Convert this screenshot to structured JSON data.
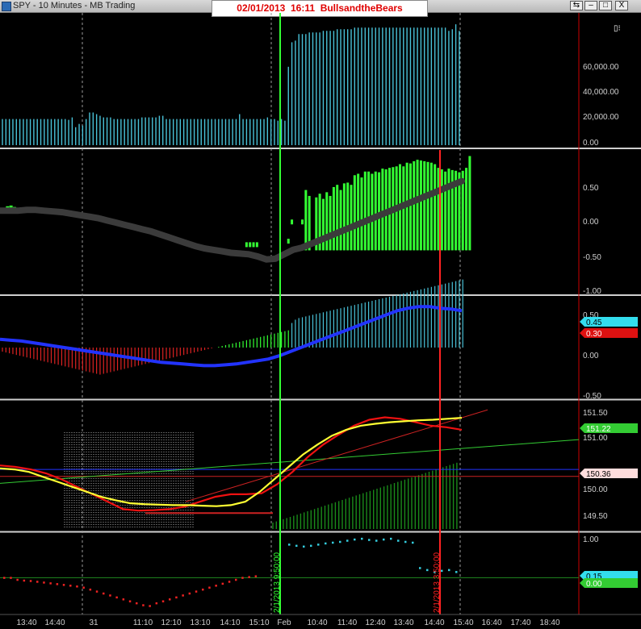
{
  "window": {
    "title": "SPY - 10 Minutes - MB Trading",
    "banner": "02/01/2013  16:11  BullsandtheBears",
    "buttons": [
      "⇆",
      "–",
      "□",
      "X"
    ]
  },
  "colors": {
    "background": "#000000",
    "volume_bars": "#49c2d8",
    "histogram_green": "#33ff33",
    "histogram_red": "#dd2222",
    "ma_line": "#3b3b3b",
    "trend_line": "#2233ff",
    "price_red": "#ee1111",
    "price_yellow": "#ffff33",
    "price_green": "#33cc33",
    "dots_cyan": "#33ccdd",
    "dots_red": "#ee2222",
    "marker_red": "#ff2222",
    "marker_green": "#33ff33",
    "axis_text": "#d0d0d0"
  },
  "chart_data": {
    "type": "bar",
    "symbol": "SPY",
    "interval": "10 Minutes",
    "x_axis": {
      "tick_labels": [
        "13:40",
        "14:40",
        "31",
        "11:10",
        "12:10",
        "13:10",
        "14:10",
        "15:10",
        "Feb",
        "10:40",
        "11:40",
        "12:40",
        "13:40",
        "14:40",
        "15:40",
        "16:40",
        "17:40",
        "18:40"
      ],
      "vertical_markers": [
        {
          "label": "2/1/2013 9:50:00",
          "color": "green"
        },
        {
          "label": "2/1/2013 3:50:00",
          "color": "red"
        }
      ]
    },
    "panels": [
      {
        "name": "volume",
        "type": "bar",
        "y_ticks": [
          "60,000.00",
          "40,000.00",
          "20,000.00",
          "0.00"
        ],
        "ylim": [
          0,
          80000
        ],
        "values": [
          16000,
          16000,
          16000,
          16000,
          16000,
          16000,
          16000,
          16000,
          16000,
          16000,
          16000,
          16000,
          16000,
          16000,
          16000,
          16000,
          16000,
          16000,
          16000,
          15500,
          17000,
          11000,
          13000,
          12000,
          16000,
          20000,
          20000,
          19000,
          18000,
          17000,
          17000,
          17000,
          16000,
          16000,
          16000,
          16000,
          16000,
          16000,
          16000,
          16000,
          17000,
          17000,
          17000,
          17000,
          17000,
          18000,
          18000,
          16000,
          16000,
          16000,
          16000,
          16000,
          16000,
          16000,
          16000,
          16000,
          16000,
          16000,
          16000,
          16000,
          16000,
          16000,
          16000,
          16000,
          16000,
          16000,
          16000,
          16000,
          19000,
          16000,
          16000,
          16000,
          16000,
          16000,
          16000,
          16000,
          17000,
          16000,
          16000,
          15000,
          16000,
          15000,
          48000,
          63000,
          64000,
          68000,
          68000,
          68000,
          69000,
          69000,
          69000,
          69000,
          70000,
          70000,
          70000,
          70000,
          71000,
          71000,
          71000,
          71000,
          71000,
          72000,
          72000,
          72000,
          72000,
          72000,
          72000,
          72000,
          72000,
          72000,
          72000,
          72000,
          72000,
          72000,
          72000,
          72000,
          72000,
          72000,
          72000,
          72000,
          72000,
          72000,
          72000,
          72000,
          72000,
          72000,
          72000,
          72000,
          70000,
          71000,
          74000,
          70000
        ]
      },
      {
        "name": "oscillator-histogram",
        "type": "bar",
        "y_ticks": [
          "0.50",
          "0.00",
          "-0.50",
          "-1.00"
        ],
        "ylim": [
          -1.0,
          0.9
        ],
        "bars": [
          0.14,
          0.16,
          0.17,
          0.15,
          0,
          0,
          0,
          0,
          0,
          0,
          0,
          0,
          0,
          0,
          0,
          0,
          0,
          0,
          0,
          0,
          0,
          0,
          0,
          0,
          0,
          0,
          0,
          0,
          0,
          0,
          0,
          0,
          0,
          0,
          0,
          0,
          0,
          0,
          0,
          0,
          0,
          0,
          0,
          0,
          0,
          0,
          0,
          0,
          0,
          0,
          0,
          0,
          0,
          0,
          0,
          0,
          0,
          0,
          0,
          0,
          0,
          0,
          0,
          0,
          0,
          0,
          0,
          0,
          0,
          0,
          -0.37,
          -0.36,
          -0.37,
          -0.39,
          0,
          0,
          0,
          0,
          0,
          0,
          0,
          0,
          -0.28,
          -0.02,
          0.0,
          0.0,
          -0.02,
          0.38,
          0.3,
          0.0,
          0.28,
          0.33,
          0.26,
          0.35,
          0.3,
          0.42,
          0.45,
          0.38,
          0.47,
          0.48,
          0.45,
          0.58,
          0.6,
          0.55,
          0.63,
          0.63,
          0.6,
          0.63,
          0.62,
          0.67,
          0.66,
          0.68,
          0.69,
          0.7,
          0.73,
          0.7,
          0.75,
          0.74,
          0.77,
          0.79,
          0.78,
          0.77,
          0.76,
          0.75,
          0.73,
          0.68,
          0.66,
          0.63,
          0.67,
          0.65,
          0.64,
          0.62,
          0.64,
          0.68,
          0.84
        ],
        "ma": [
          0.1,
          0.1,
          0.1,
          0.11,
          0.11,
          0.1,
          0.09,
          0.08,
          0.06,
          0.04,
          0.02,
          0.0,
          -0.03,
          -0.06,
          -0.09,
          -0.12,
          -0.15,
          -0.18,
          -0.22,
          -0.26,
          -0.3,
          -0.34,
          -0.38,
          -0.41,
          -0.43,
          -0.45,
          -0.47,
          -0.48,
          -0.49,
          -0.52,
          -0.56,
          -0.55,
          -0.49,
          -0.43,
          -0.4,
          -0.35,
          -0.3,
          -0.25,
          -0.2,
          -0.15,
          -0.1,
          -0.05,
          0.0,
          0.05,
          0.1,
          0.15,
          0.2,
          0.25,
          0.3,
          0.35,
          0.4,
          0.45,
          0.5
        ]
      },
      {
        "name": "macd",
        "type": "bar",
        "y_ticks": [
          "0.50",
          "0.00",
          "-0.50"
        ],
        "ylim": [
          -0.6,
          0.6
        ],
        "badges": [
          {
            "value": "0.45",
            "color": "cyan"
          },
          {
            "value": "0.30",
            "color": "red"
          }
        ],
        "histogram": [
          -0.05,
          -0.06,
          -0.07,
          -0.08,
          -0.09,
          -0.1,
          -0.11,
          -0.12,
          -0.13,
          -0.14,
          -0.15,
          -0.16,
          -0.17,
          -0.18,
          -0.19,
          -0.2,
          -0.21,
          -0.22,
          -0.23,
          -0.24,
          -0.25,
          -0.26,
          -0.27,
          -0.28,
          -0.29,
          -0.3,
          -0.31,
          -0.32,
          -0.33,
          -0.32,
          -0.31,
          -0.3,
          -0.29,
          -0.28,
          -0.27,
          -0.26,
          -0.25,
          -0.24,
          -0.23,
          -0.22,
          -0.21,
          -0.2,
          -0.19,
          -0.18,
          -0.17,
          -0.16,
          -0.15,
          -0.14,
          -0.13,
          -0.12,
          -0.11,
          -0.1,
          -0.09,
          -0.08,
          -0.07,
          -0.06,
          -0.05,
          -0.04,
          -0.03,
          -0.02,
          -0.01,
          0.0,
          0.01,
          0.02,
          0.03,
          0.04,
          0.05,
          0.06,
          0.07,
          0.08,
          0.09,
          0.1,
          0.11,
          0.12,
          0.13,
          0.14,
          0.15,
          0.16,
          0.17,
          0.18,
          0.19,
          0.2,
          0.21,
          0.3,
          0.34,
          0.36,
          0.37,
          0.38,
          0.39,
          0.4,
          0.41,
          0.42,
          0.43,
          0.44,
          0.45,
          0.46,
          0.47,
          0.48,
          0.49,
          0.5,
          0.51,
          0.52,
          0.53,
          0.54,
          0.55,
          0.56,
          0.57,
          0.58,
          0.59,
          0.6,
          0.61,
          0.62,
          0.63,
          0.64,
          0.65,
          0.66,
          0.67,
          0.68,
          0.69,
          0.7,
          0.71,
          0.72,
          0.73,
          0.74,
          0.75,
          0.76,
          0.77,
          0.78,
          0.79,
          0.8,
          0.81,
          0.82,
          0.83
        ],
        "line": [
          0.1,
          0.09,
          0.08,
          0.06,
          0.04,
          0.02,
          0.0,
          -0.02,
          -0.04,
          -0.06,
          -0.08,
          -0.1,
          -0.12,
          -0.14,
          -0.16,
          -0.18,
          -0.19,
          -0.2,
          -0.21,
          -0.22,
          -0.22,
          -0.21,
          -0.2,
          -0.18,
          -0.16,
          -0.14,
          -0.1,
          -0.05,
          0.0,
          0.05,
          0.1,
          0.15,
          0.2,
          0.25,
          0.3,
          0.35,
          0.4,
          0.45,
          0.48,
          0.5,
          0.5,
          0.48,
          0.47,
          0.45
        ]
      },
      {
        "name": "price",
        "type": "line",
        "y_ticks": [
          "151.50",
          "151.00",
          "150.00",
          "149.50"
        ],
        "ylim": [
          149.3,
          151.85
        ],
        "badges": [
          {
            "value": "151.22",
            "color": "green"
          },
          {
            "value": "150.36",
            "color": "pink"
          }
        ],
        "series": [
          {
            "color": "yellow",
            "values": [
              150.52,
              150.5,
              150.45,
              150.35,
              150.25,
              150.15,
              150.05,
              149.95,
              149.88,
              149.82,
              149.8,
              149.79,
              149.78,
              149.78,
              149.77,
              149.76,
              149.78,
              149.85,
              150.05,
              150.3,
              150.55,
              150.8,
              151.0,
              151.18,
              151.3,
              151.38,
              151.42,
              151.45,
              151.47,
              151.49,
              151.5,
              151.52,
              151.54
            ]
          },
          {
            "color": "red",
            "values": [
              150.58,
              150.55,
              150.5,
              150.42,
              150.3,
              150.15,
              150.0,
              149.85,
              149.7,
              149.67,
              149.68,
              149.7,
              149.75,
              149.85,
              149.95,
              150.0,
              150.0,
              150.02,
              150.2,
              150.45,
              150.75,
              151.0,
              151.2,
              151.38,
              151.5,
              151.55,
              151.52,
              151.45,
              151.38,
              151.35,
              151.3
            ]
          }
        ]
      },
      {
        "name": "dots-oscillator",
        "type": "scatter",
        "y_ticks": [
          "1.00",
          "0.15",
          "0.00"
        ],
        "ylim": [
          -0.9,
          1.1
        ],
        "badges": [
          {
            "value": "0.15",
            "color": "cyan"
          },
          {
            "value": "0.00",
            "color": "green"
          }
        ],
        "red_dots": [
          0.0,
          0.0,
          -0.05,
          -0.07,
          -0.08,
          -0.1,
          -0.12,
          -0.14,
          -0.16,
          -0.18,
          -0.2,
          -0.22,
          -0.25,
          -0.3,
          -0.35,
          -0.4,
          -0.45,
          -0.5,
          -0.55,
          -0.6,
          -0.65,
          -0.7,
          -0.72,
          -0.65,
          -0.6,
          -0.55,
          -0.5,
          -0.45,
          -0.4,
          -0.35,
          -0.3,
          -0.25,
          -0.2,
          -0.15,
          -0.1,
          -0.05,
          0.0,
          0.02,
          0.04
        ],
        "cyan_dots": [
          0.85,
          0.82,
          0.8,
          0.82,
          0.85,
          0.88,
          0.9,
          0.92,
          0.95,
          0.98,
          1.0,
          0.97,
          0.95,
          0.98,
          1.0,
          0.95,
          0.92,
          0.9,
          0.25,
          0.2,
          0.15,
          0.18,
          0.2,
          0.15
        ]
      }
    ]
  }
}
